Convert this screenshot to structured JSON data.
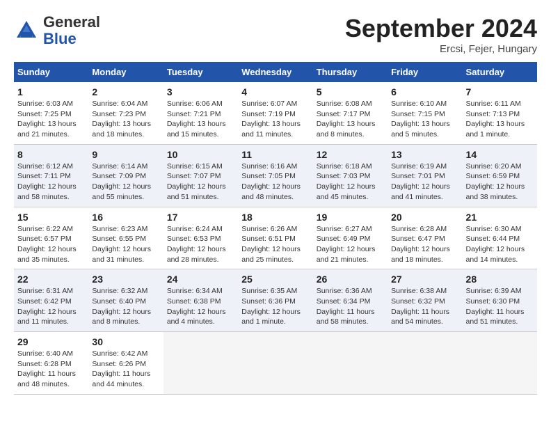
{
  "header": {
    "logo_general": "General",
    "logo_blue": "Blue",
    "month": "September 2024",
    "location": "Ercsi, Fejer, Hungary"
  },
  "columns": [
    "Sunday",
    "Monday",
    "Tuesday",
    "Wednesday",
    "Thursday",
    "Friday",
    "Saturday"
  ],
  "weeks": [
    [
      {
        "day": "1",
        "info": "Sunrise: 6:03 AM\nSunset: 7:25 PM\nDaylight: 13 hours\nand 21 minutes."
      },
      {
        "day": "2",
        "info": "Sunrise: 6:04 AM\nSunset: 7:23 PM\nDaylight: 13 hours\nand 18 minutes."
      },
      {
        "day": "3",
        "info": "Sunrise: 6:06 AM\nSunset: 7:21 PM\nDaylight: 13 hours\nand 15 minutes."
      },
      {
        "day": "4",
        "info": "Sunrise: 6:07 AM\nSunset: 7:19 PM\nDaylight: 13 hours\nand 11 minutes."
      },
      {
        "day": "5",
        "info": "Sunrise: 6:08 AM\nSunset: 7:17 PM\nDaylight: 13 hours\nand 8 minutes."
      },
      {
        "day": "6",
        "info": "Sunrise: 6:10 AM\nSunset: 7:15 PM\nDaylight: 13 hours\nand 5 minutes."
      },
      {
        "day": "7",
        "info": "Sunrise: 6:11 AM\nSunset: 7:13 PM\nDaylight: 13 hours\nand 1 minute."
      }
    ],
    [
      {
        "day": "8",
        "info": "Sunrise: 6:12 AM\nSunset: 7:11 PM\nDaylight: 12 hours\nand 58 minutes."
      },
      {
        "day": "9",
        "info": "Sunrise: 6:14 AM\nSunset: 7:09 PM\nDaylight: 12 hours\nand 55 minutes."
      },
      {
        "day": "10",
        "info": "Sunrise: 6:15 AM\nSunset: 7:07 PM\nDaylight: 12 hours\nand 51 minutes."
      },
      {
        "day": "11",
        "info": "Sunrise: 6:16 AM\nSunset: 7:05 PM\nDaylight: 12 hours\nand 48 minutes."
      },
      {
        "day": "12",
        "info": "Sunrise: 6:18 AM\nSunset: 7:03 PM\nDaylight: 12 hours\nand 45 minutes."
      },
      {
        "day": "13",
        "info": "Sunrise: 6:19 AM\nSunset: 7:01 PM\nDaylight: 12 hours\nand 41 minutes."
      },
      {
        "day": "14",
        "info": "Sunrise: 6:20 AM\nSunset: 6:59 PM\nDaylight: 12 hours\nand 38 minutes."
      }
    ],
    [
      {
        "day": "15",
        "info": "Sunrise: 6:22 AM\nSunset: 6:57 PM\nDaylight: 12 hours\nand 35 minutes."
      },
      {
        "day": "16",
        "info": "Sunrise: 6:23 AM\nSunset: 6:55 PM\nDaylight: 12 hours\nand 31 minutes."
      },
      {
        "day": "17",
        "info": "Sunrise: 6:24 AM\nSunset: 6:53 PM\nDaylight: 12 hours\nand 28 minutes."
      },
      {
        "day": "18",
        "info": "Sunrise: 6:26 AM\nSunset: 6:51 PM\nDaylight: 12 hours\nand 25 minutes."
      },
      {
        "day": "19",
        "info": "Sunrise: 6:27 AM\nSunset: 6:49 PM\nDaylight: 12 hours\nand 21 minutes."
      },
      {
        "day": "20",
        "info": "Sunrise: 6:28 AM\nSunset: 6:47 PM\nDaylight: 12 hours\nand 18 minutes."
      },
      {
        "day": "21",
        "info": "Sunrise: 6:30 AM\nSunset: 6:44 PM\nDaylight: 12 hours\nand 14 minutes."
      }
    ],
    [
      {
        "day": "22",
        "info": "Sunrise: 6:31 AM\nSunset: 6:42 PM\nDaylight: 12 hours\nand 11 minutes."
      },
      {
        "day": "23",
        "info": "Sunrise: 6:32 AM\nSunset: 6:40 PM\nDaylight: 12 hours\nand 8 minutes."
      },
      {
        "day": "24",
        "info": "Sunrise: 6:34 AM\nSunset: 6:38 PM\nDaylight: 12 hours\nand 4 minutes."
      },
      {
        "day": "25",
        "info": "Sunrise: 6:35 AM\nSunset: 6:36 PM\nDaylight: 12 hours\nand 1 minute."
      },
      {
        "day": "26",
        "info": "Sunrise: 6:36 AM\nSunset: 6:34 PM\nDaylight: 11 hours\nand 58 minutes."
      },
      {
        "day": "27",
        "info": "Sunrise: 6:38 AM\nSunset: 6:32 PM\nDaylight: 11 hours\nand 54 minutes."
      },
      {
        "day": "28",
        "info": "Sunrise: 6:39 AM\nSunset: 6:30 PM\nDaylight: 11 hours\nand 51 minutes."
      }
    ],
    [
      {
        "day": "29",
        "info": "Sunrise: 6:40 AM\nSunset: 6:28 PM\nDaylight: 11 hours\nand 48 minutes."
      },
      {
        "day": "30",
        "info": "Sunrise: 6:42 AM\nSunset: 6:26 PM\nDaylight: 11 hours\nand 44 minutes."
      },
      {
        "day": "",
        "info": ""
      },
      {
        "day": "",
        "info": ""
      },
      {
        "day": "",
        "info": ""
      },
      {
        "day": "",
        "info": ""
      },
      {
        "day": "",
        "info": ""
      }
    ]
  ]
}
